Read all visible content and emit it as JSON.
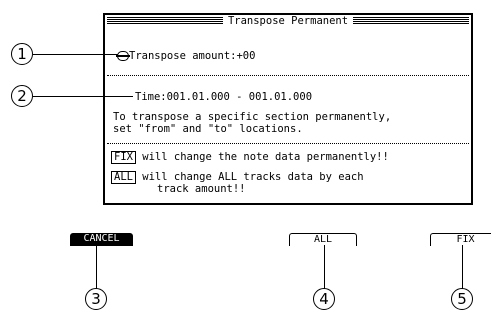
{
  "dialog": {
    "title": "Transpose Permanent",
    "transpose_label": "Transpose amount:",
    "transpose_value": "+00",
    "time_label": "Time:",
    "time_from": "001.01.000",
    "time_separator": " - ",
    "time_to": "001.01.000",
    "instruction_line1": "To transpose a specific section permanently,",
    "instruction_line2": "set \"from\" and \"to\" locations.",
    "fix_tag": "FIX",
    "fix_note": " will change the note data permanently!!",
    "all_tag": "ALL",
    "all_note_line1": " will change ALL tracks data by each",
    "all_note_line2": "track amount!!"
  },
  "softkeys": {
    "cancel_label": "CANCEL",
    "all_label": "ALL",
    "fix_label": "FIX"
  },
  "callouts": [
    "1",
    "2",
    "3",
    "4",
    "5"
  ],
  "icons": {
    "knob": "rotary-knob-icon"
  }
}
